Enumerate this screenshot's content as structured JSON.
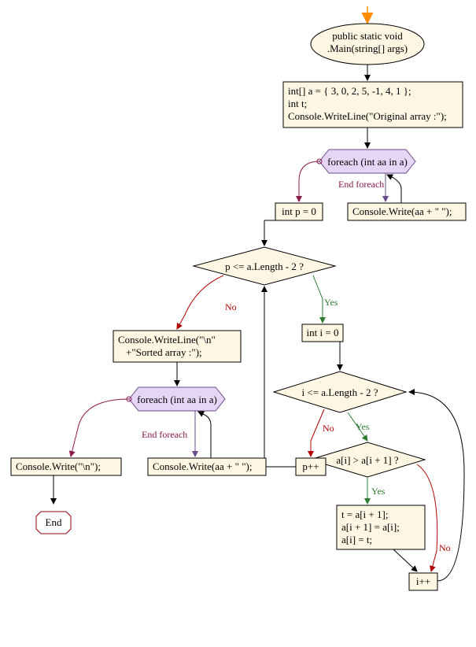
{
  "chart_data": {
    "type": "flowchart",
    "nodes": {
      "start": {
        "label1": "public static void",
        "label2": ".Main(string[] args)",
        "kind": "start"
      },
      "init": {
        "line1": "int[] a = { 3, 0, 2, 5, -1, 4, 1 };",
        "line2": "int t;",
        "line3": "Console.WriteLine(\"Original array :\");",
        "kind": "process"
      },
      "foreach1": {
        "label": "foreach (int aa in a)",
        "kind": "loop"
      },
      "write1": {
        "label": "Console.Write(aa + \" \");",
        "kind": "process"
      },
      "pinit": {
        "label": "int p = 0",
        "kind": "process"
      },
      "pcond": {
        "label": "p <= a.Length - 2 ?",
        "kind": "decision"
      },
      "iinit": {
        "label": "int i = 0",
        "kind": "process"
      },
      "icond": {
        "label": "i <= a.Length - 2 ?",
        "kind": "decision"
      },
      "acomp": {
        "label": "a[i] > a[i + 1] ?",
        "kind": "decision"
      },
      "swap": {
        "line1": "t = a[i + 1];",
        "line2": "a[i + 1] = a[i];",
        "line3": "a[i] = t;",
        "kind": "process"
      },
      "iinc": {
        "label": "i++",
        "kind": "process"
      },
      "pinc": {
        "label": "p++",
        "kind": "process"
      },
      "sorted": {
        "line1": "Console.WriteLine(\"\\n\"",
        "line2": "+\"Sorted array :\");",
        "kind": "process"
      },
      "foreach2": {
        "label": "foreach (int aa in a)",
        "kind": "loop"
      },
      "write2": {
        "label": "Console.Write(aa + \" \");",
        "kind": "process"
      },
      "newline": {
        "label": "Console.Write(\"\\n\");",
        "kind": "process"
      },
      "end": {
        "label": "End",
        "kind": "end"
      }
    },
    "edge_labels": {
      "yes": "Yes",
      "no": "No",
      "end_foreach": "End foreach"
    }
  }
}
